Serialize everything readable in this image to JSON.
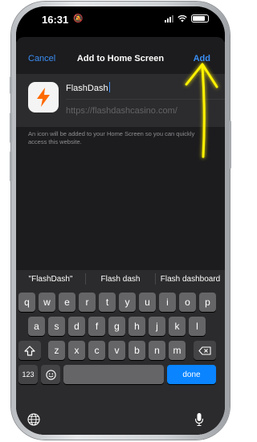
{
  "status_bar": {
    "time": "16:31"
  },
  "dialog": {
    "cancel_label": "Cancel",
    "title": "Add to Home Screen",
    "add_label": "Add"
  },
  "app": {
    "name_value": "FlashDash",
    "url": "https://flashdashcasino.com/",
    "hint": "An icon will be added to your Home Screen so you can quickly access this website."
  },
  "suggestions": [
    "\"FlashDash\"",
    "Flash dash",
    "Flash dashboard"
  ],
  "keyboard": {
    "row1": [
      "q",
      "w",
      "e",
      "r",
      "t",
      "y",
      "u",
      "i",
      "o",
      "p"
    ],
    "row2": [
      "a",
      "s",
      "d",
      "f",
      "g",
      "h",
      "j",
      "k",
      "l"
    ],
    "row3": [
      "z",
      "x",
      "c",
      "v",
      "b",
      "n",
      "m"
    ],
    "numbers_label": "123",
    "done_label": "done"
  },
  "colors": {
    "accent": "#3a8ef5",
    "annotation": "#fff200",
    "icon_orange": "#ff6a00"
  }
}
